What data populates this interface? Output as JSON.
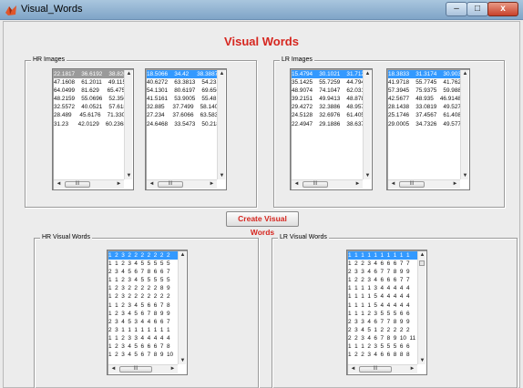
{
  "window": {
    "title": "Visual_Words",
    "min_glyph": "–",
    "max_glyph": "□",
    "close_glyph": "x"
  },
  "main_title": "Visual Words",
  "hr_images": {
    "title": "HR Images",
    "list1": [
      "22.1817    36.6192    38.820",
      "47.1608    61.2011    49.115",
      "64.0499    81.629     65.4758",
      "48.2159    55.0696    52.350",
      "32.5572    40.0521    57.618",
      "28.489     45.6176    71.3301",
      "31.23      42.0129    60.2368"
    ],
    "list2": [
      "18.5066    34.42     38.3887",
      "40.6272    63.3813    54.2318",
      "54.1301    80.6197    69.6566",
      "41.5161    53.9005    55.48",
      "32.885     37.7499    58.1408",
      "27.234     37.6066    63.5835",
      "24.6468    33.5473    50.2186"
    ]
  },
  "lr_images": {
    "title": "LR Images",
    "list1": [
      "15.4794    30.1021    31.712",
      "35.1425    55.7259    44.794",
      "48.9074    74.1047    62.0315",
      "39.2151    49.9413    48.8786",
      "29.4272    32.3886    48.957",
      "24.5128    32.6976    61.405",
      "22.4947    29.1886    38.637"
    ],
    "list2": [
      "18.3833    31.3174    30.903",
      "41.9718    55.7745    41.762",
      "57.3945    75.9375    59.988",
      "42.5677    48.935    46.9148",
      "28.1438    33.0819    49.527",
      "25.1746    37.4567    61.408",
      "29.0005    34.7326    49.577"
    ]
  },
  "create_button": "Create Visual Words",
  "hr_visual_words": {
    "title": "HR Visual Words",
    "rows": [
      "1  2  3  2  2  2  2  2  2  2",
      "1  1  2  3  4  5  5  5  5  5",
      "2  3  4  5  6  7  8  6  6  7",
      "1  1  2  3  4  5  5  5  5  5",
      "1  2  3  2  2  2  2  2  8  9",
      "1  2  3  2  2  2  2  2  2  2",
      "1  1  2  3  4  5  6  6  7  8",
      "1  2  3  4  5  6  7  8  9  9",
      "2  3  4  5  3  4  4  6  6  7",
      "2  3  1  1  1  1  1  1  1  1",
      "1  1  2  3  3  4  4  4  4  4",
      "1  2  3  4  5  6  6  6  7  8",
      "1  2  3  4  5  6  7  8  9  10"
    ]
  },
  "lr_visual_words": {
    "title": "LR Visual Words",
    "rows": [
      "1  1  1  1  1  1  1  1  1  1",
      "1  2  2  3  4  6  6  6  7  7",
      "2  3  3  4  6  7  7  8  9  9",
      "1  2  2  3  4  6  6  6  7  7",
      "1  1  1  1  3  4  4  4  4  4",
      "1  1  1  1  5  4  4  4  4  4",
      "1  1  1  1  5  4  4  4  4  4",
      "1  1  1  2  3  5  5  5  6  6",
      "2  3  3  4  6  7  7  8  9  9",
      "2  3  4  5  1  2  2  2  2  2",
      "2  2  3  4  6  7  8  9  10  11",
      "1  1  1  2  3  5  5  5  6  6",
      "1  2  2  3  4  6  6  8  8  8"
    ]
  },
  "scroll": {
    "up": "▲",
    "down": "▼",
    "left": "◄",
    "right": "►",
    "grip": "III"
  },
  "colors": {
    "title_red": "#d6261f",
    "selection_blue": "#3399ff",
    "selection_gray": "#9a9a9a"
  }
}
